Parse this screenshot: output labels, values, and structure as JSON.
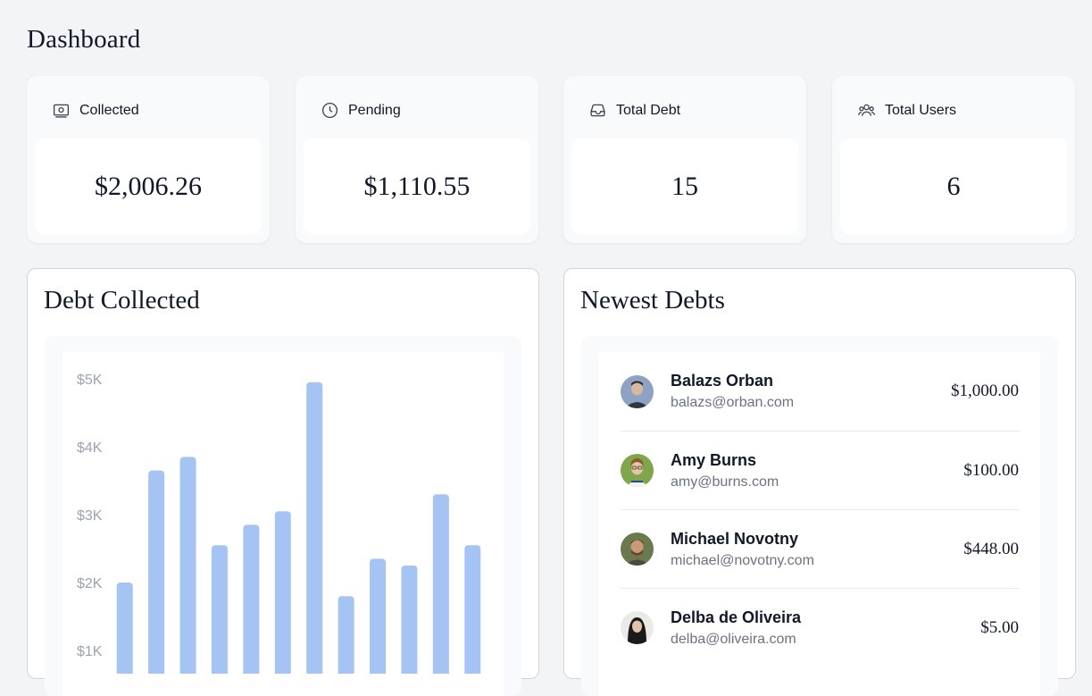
{
  "page": {
    "title": "Dashboard"
  },
  "stats": [
    {
      "label": "Collected",
      "value": "$2,006.26",
      "icon": "banknote-icon"
    },
    {
      "label": "Pending",
      "value": "$1,110.55",
      "icon": "clock-icon"
    },
    {
      "label": "Total Debt",
      "value": "15",
      "icon": "inbox-icon"
    },
    {
      "label": "Total Users",
      "value": "6",
      "icon": "users-icon"
    }
  ],
  "debt_collected": {
    "title": "Debt Collected"
  },
  "newest_debts": {
    "title": "Newest Debts",
    "items": [
      {
        "name": "Balazs Orban",
        "email": "balazs@orban.com",
        "amount": "$1,000.00"
      },
      {
        "name": "Amy Burns",
        "email": "amy@burns.com",
        "amount": "$100.00"
      },
      {
        "name": "Michael Novotny",
        "email": "michael@novotny.com",
        "amount": "$448.00"
      },
      {
        "name": "Delba de Oliveira",
        "email": "delba@oliveira.com",
        "amount": "$5.00"
      }
    ]
  },
  "chart_data": {
    "type": "bar",
    "title": "Debt Collected",
    "xlabel": "",
    "ylabel": "",
    "y_tick_labels": [
      "$5K",
      "$4K",
      "$3K",
      "$2K",
      "$1K"
    ],
    "y_ticks": [
      5000,
      4000,
      3000,
      2000,
      1000
    ],
    "ylim": [
      0,
      5000
    ],
    "bar_color": "#a5c3f3",
    "values": [
      2000,
      3650,
      3850,
      2550,
      2850,
      3050,
      4950,
      1800,
      2350,
      2250,
      3300,
      2550
    ],
    "grid": false
  },
  "colors": {
    "bar": "#a5c3f3",
    "background": "#f3f4f6",
    "card": "#f9fafb"
  }
}
